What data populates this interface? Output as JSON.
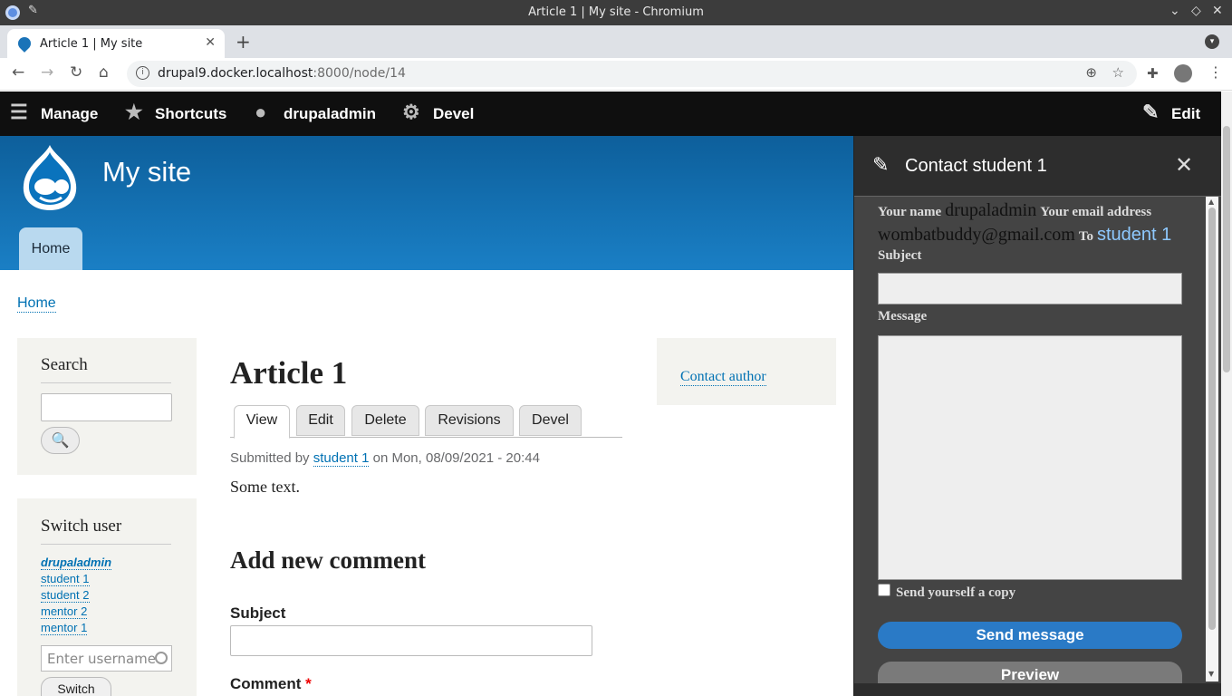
{
  "window": {
    "title": "Article 1 | My site - Chromium"
  },
  "browser": {
    "tab_title": "Article 1 | My site",
    "url_host": "drupal9.docker.localhost",
    "url_path": ":8000/node/14"
  },
  "drupal_toolbar": {
    "manage": "Manage",
    "shortcuts": "Shortcuts",
    "user": "drupaladmin",
    "devel": "Devel",
    "edit": "Edit"
  },
  "header": {
    "site_name": "My site",
    "nav_home": "Home"
  },
  "breadcrumb": "Home",
  "search_block": {
    "title": "Search"
  },
  "switch_user": {
    "title": "Switch user",
    "users": [
      "drupaladmin",
      "student 1",
      "student 2",
      "mentor 2",
      "mentor 1"
    ],
    "placeholder": "Enter username",
    "button": "Switch"
  },
  "article": {
    "title": "Article 1",
    "tabs": [
      "View",
      "Edit",
      "Delete",
      "Revisions",
      "Devel"
    ],
    "submitted_prefix": "Submitted by",
    "author": "student 1",
    "submitted_suffix": "on Mon, 08/09/2021 - 20:44",
    "body": "Some text."
  },
  "comment_form": {
    "heading": "Add new comment",
    "subject_label": "Subject",
    "comment_label": "Comment",
    "required_mark": "*"
  },
  "contact_block": {
    "link": "Contact author"
  },
  "dialog": {
    "title": "Contact student 1",
    "your_name_label": "Your name",
    "your_name_value": "drupaladmin",
    "email_label": "Your email address",
    "email_value": "wombatbuddy@gmail.com",
    "to_label": "To",
    "to_value": "student 1",
    "subject_label": "Subject",
    "message_label": "Message",
    "copy_label": "Send yourself a copy",
    "send_button": "Send message",
    "preview_button": "Preview"
  },
  "colors": {
    "link": "#0071b3",
    "header": "#1a7fc5",
    "toolbar": "#0f0f0f",
    "dialog": "#444444",
    "primary_button": "#2a7ac6"
  }
}
